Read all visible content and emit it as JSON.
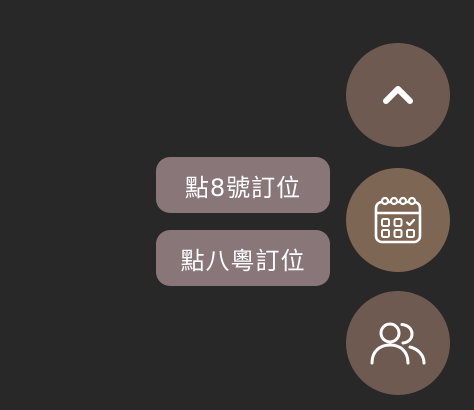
{
  "labels": {
    "booking_8": "點8號訂位",
    "booking_8_mo": "點八粵訂位"
  },
  "icons": {
    "scroll_top": "chevron-up-icon",
    "calendar": "calendar-icon",
    "users": "users-icon"
  },
  "colors": {
    "background": "#292828",
    "fab": "#6f5a52",
    "fab_calendar": "#7d6654",
    "pill": "#897679",
    "foreground": "#ffffff"
  }
}
